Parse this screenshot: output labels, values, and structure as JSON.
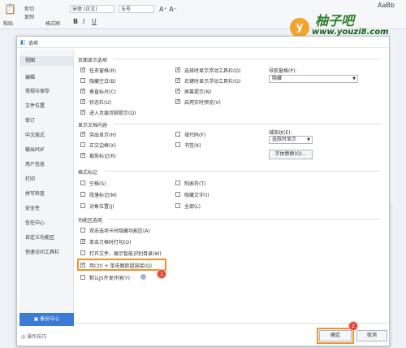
{
  "ribbon": {
    "paste_label": "粘贴",
    "cut_label": "剪切",
    "copy_label": "复制",
    "format_painter_label": "格式刷",
    "font_name": "宋体 (正文)",
    "font_size": "五号",
    "style_preview": "AaBb"
  },
  "watermark": {
    "logo_char": "y",
    "title": "柚子吧",
    "url": "www.youzi8.com"
  },
  "dialog": {
    "title": "选项",
    "sidebar_items": [
      "视图",
      "编辑",
      "常规与保存",
      "文件位置",
      "修订",
      "中文版式",
      "输出PDF",
      "用户信息",
      "打印",
      "拼写检查",
      "安全性",
      "信任中心",
      "自定义功能区",
      "快速访问工具栏"
    ],
    "sync_button": "备份中心",
    "tips_link": "操作技巧",
    "page_display": {
      "heading": "页面显示选项",
      "options": [
        {
          "label": "任务窗格(R)",
          "checked": true
        },
        {
          "label": "隐藏空白(B)",
          "checked": false
        },
        {
          "label": "垂直标尺(C)",
          "checked": true
        },
        {
          "label": "状态栏(U)",
          "checked": true
        },
        {
          "label": "进入页眉页脚提示(Q)",
          "checked": true
        }
      ],
      "options_col2": [
        {
          "label": "选择时显示浮动工具栏(D)",
          "checked": true
        },
        {
          "label": "右键时显示浮动工具栏(G)",
          "checked": true
        },
        {
          "label": "屏幕提示(N)",
          "checked": true
        },
        {
          "label": "启用实时预览(V)",
          "checked": true
        }
      ],
      "nav_label": "导航窗格(P):",
      "nav_value": "隐藏"
    },
    "doc_content": {
      "heading": "显示文档内容",
      "options": [
        {
          "label": "突出显示(H)",
          "checked": true
        },
        {
          "label": "正文边框(X)",
          "checked": false
        },
        {
          "label": "裁剪标记(R)",
          "checked": true
        }
      ],
      "options_col2": [
        {
          "label": "域代码(F)",
          "checked": false
        },
        {
          "label": "书签(K)",
          "checked": false
        }
      ],
      "shading_label": "域底纹(E):",
      "shading_value": "选取时显示",
      "font_replace_button": "字体替换(O)..."
    },
    "format_marks": {
      "heading": "格式标记",
      "options": [
        {
          "label": "空格(S)",
          "checked": false
        },
        {
          "label": "段落标记(M)",
          "checked": false
        },
        {
          "label": "对象位置(J)",
          "checked": false
        }
      ],
      "options_col2": [
        {
          "label": "制表符(T)",
          "checked": false
        },
        {
          "label": "隐藏文字(I)",
          "checked": false
        },
        {
          "label": "全部(L)",
          "checked": false
        }
      ]
    },
    "function_area": {
      "heading": "功能区选项",
      "options": [
        {
          "label": "双击选项卡时隐藏功能区(A)",
          "checked": false
        },
        {
          "label": "单击方框时打勾(O)",
          "checked": true
        },
        {
          "label": "打开文件，展示智能识别目录(W)",
          "checked": false
        },
        {
          "label": "用Ctrl + 单击跟踪超链接(Q)",
          "checked": true
        },
        {
          "label": "默认JS开发环境(Y)",
          "checked": false
        }
      ]
    },
    "ok_button": "确定",
    "cancel_button": "取消",
    "step_badges": [
      "1",
      "2"
    ],
    "colors": {
      "highlight": "#f0922b",
      "badge": "#e0463a",
      "sync_button": "#3b7bd6"
    }
  }
}
